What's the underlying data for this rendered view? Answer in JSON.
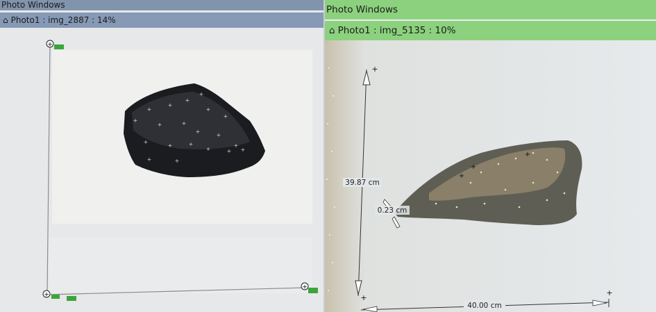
{
  "left_window": {
    "title": "Photo Windows",
    "subtitle": "Photo1 : img_2887 : 14%",
    "subtitle_icon": "house-icon"
  },
  "right_window": {
    "title": "Photo Windows",
    "subtitle": "Photo1 : img_5135 : 10%",
    "subtitle_icon": "house-icon",
    "measurements": {
      "height": "39.87 cm",
      "width": "40.00 cm",
      "angle": "0.23 cm"
    }
  },
  "colors": {
    "left_titlebar": "#8194ad",
    "right_titlebar": "#8cd17e"
  }
}
